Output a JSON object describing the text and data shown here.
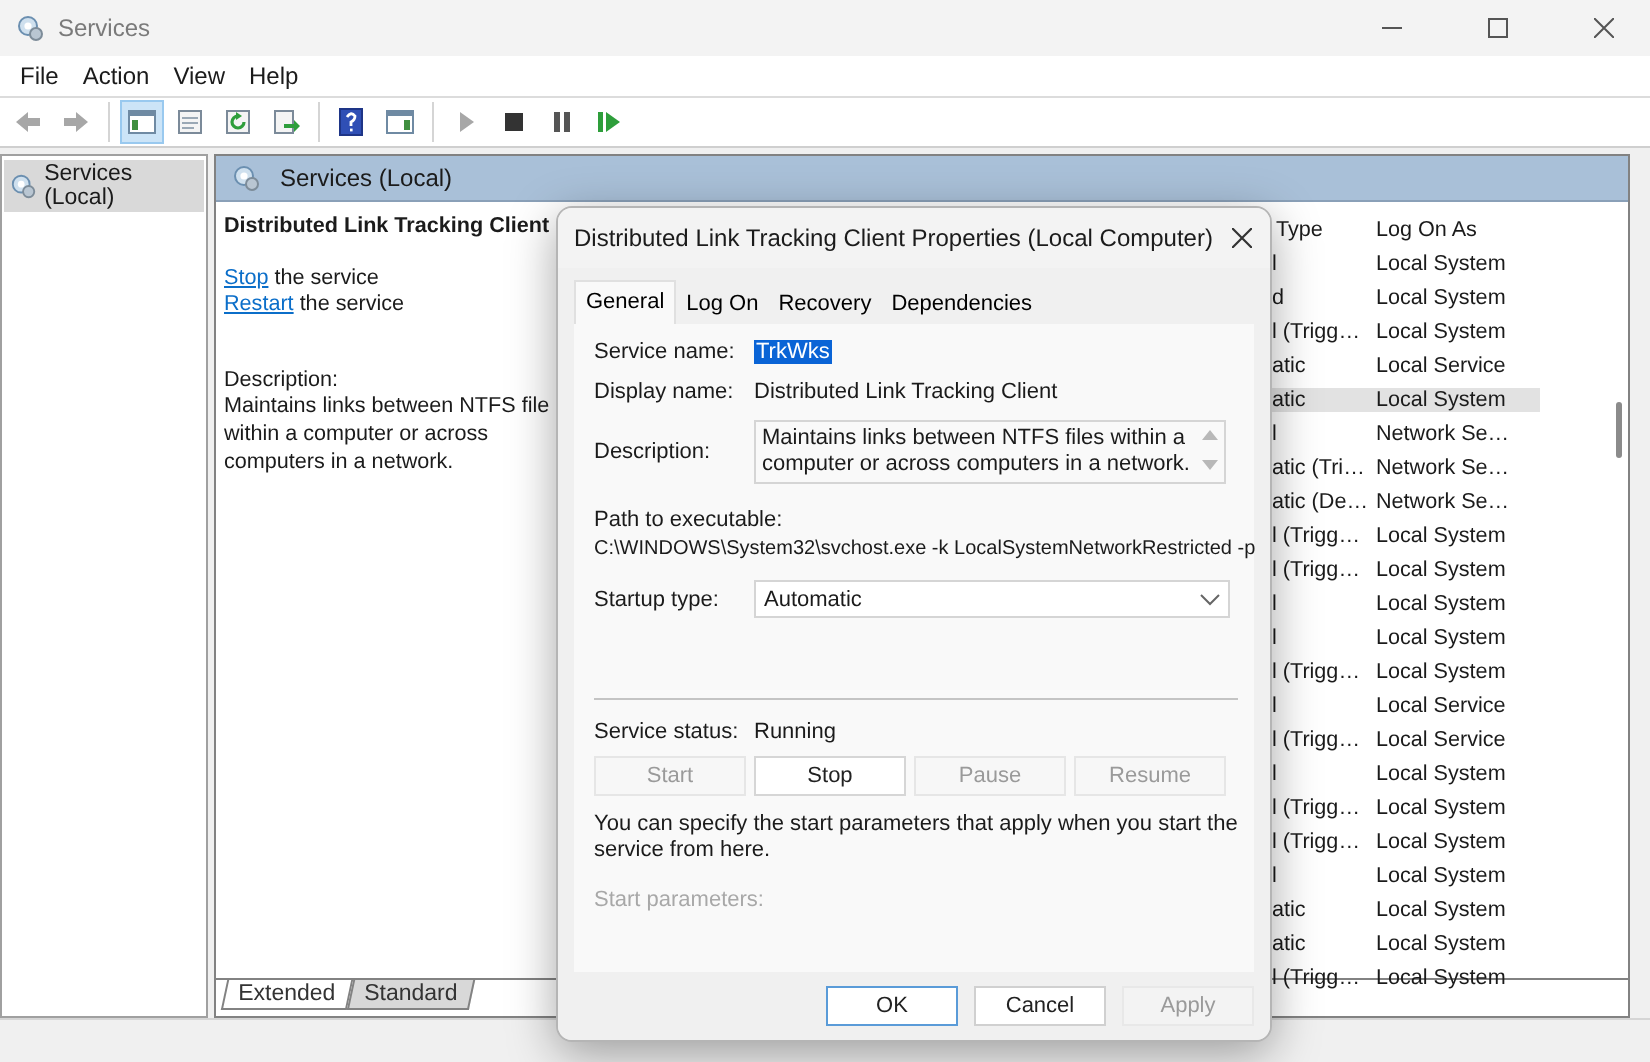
{
  "window": {
    "title": "Services"
  },
  "menu": [
    "File",
    "Action",
    "View",
    "Help"
  ],
  "toolbar_groups": [
    {
      "buttons": [
        {
          "kind": "back",
          "disabled": true,
          "pressed": false
        },
        {
          "kind": "forward",
          "disabled": true,
          "pressed": false
        }
      ]
    },
    {
      "buttons": [
        {
          "kind": "console-tree",
          "disabled": false,
          "pressed": true
        },
        {
          "kind": "properties",
          "disabled": false,
          "pressed": false
        },
        {
          "kind": "refresh",
          "disabled": false,
          "pressed": false
        },
        {
          "kind": "export",
          "disabled": false,
          "pressed": false
        }
      ]
    },
    {
      "buttons": [
        {
          "kind": "help",
          "disabled": false,
          "pressed": false
        },
        {
          "kind": "action-pane",
          "disabled": false,
          "pressed": false
        }
      ]
    },
    {
      "buttons": [
        {
          "kind": "start",
          "disabled": true,
          "pressed": false
        },
        {
          "kind": "stop",
          "disabled": false,
          "pressed": false
        },
        {
          "kind": "pause",
          "disabled": false,
          "pressed": false
        },
        {
          "kind": "restart",
          "disabled": false,
          "pressed": false
        }
      ]
    }
  ],
  "tree": {
    "items": [
      {
        "label": "Services (Local)",
        "selected": true
      }
    ]
  },
  "pane": {
    "title": "Services (Local)"
  },
  "details": {
    "service_title": "Distributed Link Tracking Client",
    "actions": [
      {
        "link": "Stop",
        "text": "the service"
      },
      {
        "link": "Restart",
        "text": "the service"
      }
    ],
    "description_label": "Description:",
    "description_lines": [
      "Maintains links between NTFS file",
      "within a computer or across",
      "computers in a network."
    ]
  },
  "list": {
    "columns": [
      "Type",
      "Log On As"
    ],
    "rows": [
      {
        "type": "l",
        "log_on_as": "Local System",
        "selected": false
      },
      {
        "type": "d",
        "log_on_as": "Local System",
        "selected": false
      },
      {
        "type": "l (Trigg…",
        "log_on_as": "Local System",
        "selected": false
      },
      {
        "type": "atic",
        "log_on_as": "Local Service",
        "selected": false
      },
      {
        "type": "atic",
        "log_on_as": "Local System",
        "selected": true
      },
      {
        "type": "l",
        "log_on_as": "Network Se…",
        "selected": false
      },
      {
        "type": "atic (Tri…",
        "log_on_as": "Network Se…",
        "selected": false
      },
      {
        "type": "atic (De…",
        "log_on_as": "Network Se…",
        "selected": false
      },
      {
        "type": "l (Trigg…",
        "log_on_as": "Local System",
        "selected": false
      },
      {
        "type": "l (Trigg…",
        "log_on_as": "Local System",
        "selected": false
      },
      {
        "type": "l",
        "log_on_as": "Local System",
        "selected": false
      },
      {
        "type": "l",
        "log_on_as": "Local System",
        "selected": false
      },
      {
        "type": "l (Trigg…",
        "log_on_as": "Local System",
        "selected": false
      },
      {
        "type": "l",
        "log_on_as": "Local Service",
        "selected": false
      },
      {
        "type": "l (Trigg…",
        "log_on_as": "Local Service",
        "selected": false
      },
      {
        "type": "l",
        "log_on_as": "Local System",
        "selected": false
      },
      {
        "type": "l (Trigg…",
        "log_on_as": "Local System",
        "selected": false
      },
      {
        "type": "l (Trigg…",
        "log_on_as": "Local System",
        "selected": false
      },
      {
        "type": "l",
        "log_on_as": "Local System",
        "selected": false
      },
      {
        "type": "atic",
        "log_on_as": "Local System",
        "selected": false
      },
      {
        "type": "atic",
        "log_on_as": "Local System",
        "selected": false
      },
      {
        "type": "l (Trigg…",
        "log_on_as": "Local System",
        "selected": false
      }
    ]
  },
  "view_tabs": [
    {
      "label": "Extended",
      "selected": true
    },
    {
      "label": "Standard",
      "selected": false
    }
  ],
  "dialog": {
    "title": "Distributed Link Tracking Client Properties (Local Computer)",
    "tabs": [
      {
        "label": "General",
        "selected": true
      },
      {
        "label": "Log On",
        "selected": false
      },
      {
        "label": "Recovery",
        "selected": false
      },
      {
        "label": "Dependencies",
        "selected": false
      }
    ],
    "service_name": {
      "label": "Service name:",
      "value": "TrkWks",
      "highlighted": true
    },
    "display_name": {
      "label": "Display name:",
      "value": "Distributed Link Tracking Client"
    },
    "description": {
      "label": "Description:",
      "value": "Maintains links between NTFS files within a computer or across computers in a network."
    },
    "path": {
      "label": "Path to executable:",
      "value": "C:\\WINDOWS\\System32\\svchost.exe -k LocalSystemNetworkRestricted -p"
    },
    "startup_type": {
      "label": "Startup type:",
      "value": "Automatic"
    },
    "status": {
      "label": "Service status:",
      "value": "Running"
    },
    "service_buttons": [
      {
        "label": "Start",
        "disabled": true
      },
      {
        "label": "Stop",
        "disabled": false
      },
      {
        "label": "Pause",
        "disabled": true
      },
      {
        "label": "Resume",
        "disabled": true
      }
    ],
    "note": "You can specify the start parameters that apply when you start the service from here.",
    "start_parameters": {
      "label": "Start parameters:",
      "disabled": true
    },
    "buttons": [
      {
        "label": "OK",
        "default": true,
        "disabled": false
      },
      {
        "label": "Cancel",
        "default": false,
        "disabled": false
      },
      {
        "label": "Apply",
        "default": false,
        "disabled": true
      }
    ]
  }
}
